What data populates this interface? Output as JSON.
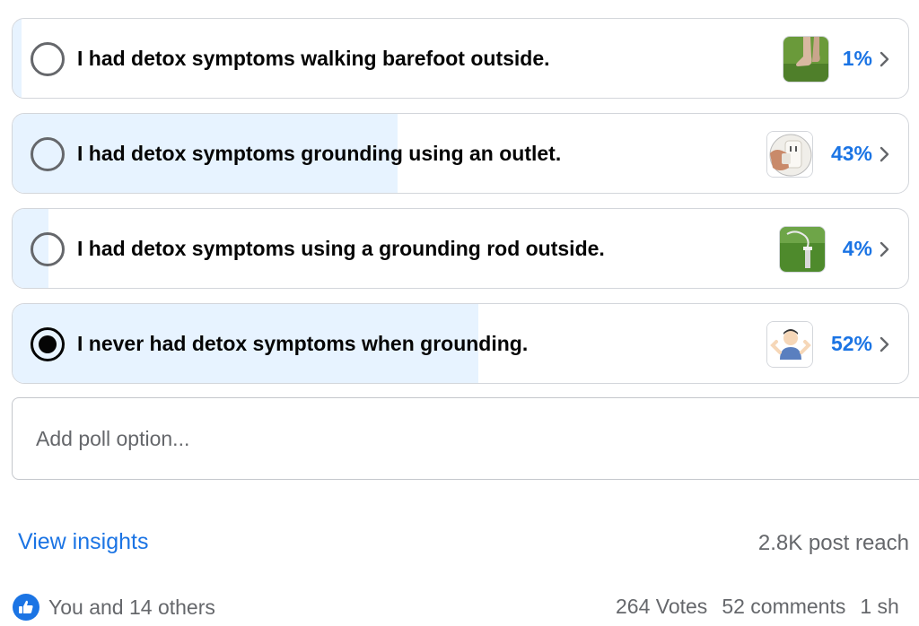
{
  "poll": {
    "options": [
      {
        "label": "I had detox symptoms walking barefoot outside.",
        "percent_text": "1%",
        "percent": 1,
        "selected": false,
        "thumbnail": "bare-feet-on-grass-photo"
      },
      {
        "label": "I had detox symptoms grounding using an outlet.",
        "percent_text": "43%",
        "percent": 43,
        "selected": false,
        "thumbnail": "wall-outlet-plug-photo"
      },
      {
        "label": "I had detox symptoms using a grounding rod outside.",
        "percent_text": "4%",
        "percent": 4,
        "selected": false,
        "thumbnail": "grounding-rod-in-grass-photo"
      },
      {
        "label": "I never had detox symptoms when grounding.",
        "percent_text": "52%",
        "percent": 52,
        "selected": true,
        "thumbnail": "person-shrugging-emoji"
      }
    ],
    "add_option_placeholder": "Add poll option..."
  },
  "footer": {
    "view_insights": "View insights",
    "post_reach": "2.8K post reach",
    "likes_text": "You and 14 others",
    "votes": "264 Votes",
    "comments": "52 comments",
    "shares_partial": "1 sh"
  },
  "colors": {
    "accent": "#1b74e4",
    "fill": "#e7f3ff",
    "border": "#d3d6db",
    "muted_text": "#65676b"
  }
}
